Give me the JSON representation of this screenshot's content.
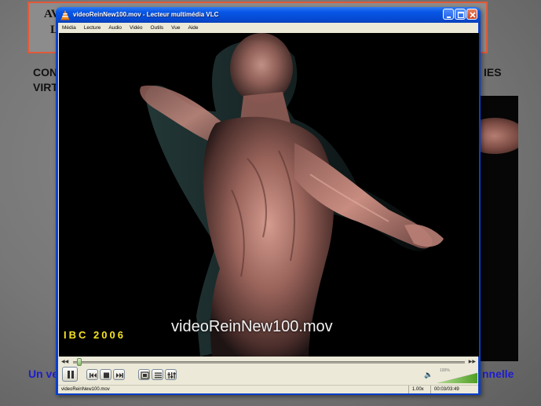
{
  "slide": {
    "fragment_1": "AV",
    "fragment_2": "L",
    "title_left_1": "CON",
    "title_left_2": "VIRT",
    "title_right": "IES",
    "bottom_left": "Un ve",
    "bottom_right": "nnelle"
  },
  "window": {
    "title": "videoReinNew100.mov - Lecteur multimédia VLC",
    "minimize_icon": "minimize-icon",
    "maximize_icon": "maximize-icon",
    "close_icon": "close-icon"
  },
  "menu": [
    "Média",
    "Lecture",
    "Audio",
    "Vidéo",
    "Outils",
    "Vue",
    "Aide"
  ],
  "video": {
    "watermark": "IBC 2006",
    "caption": "videoReinNew100.mov",
    "watermark_color": "#f5e222"
  },
  "controls": {
    "progress": 0.01,
    "volume_percent": "100%",
    "volume_icon": "speaker-icon"
  },
  "status": {
    "filename": "videoReinNew100.mov",
    "speed": "1.00x",
    "time": "00:03/03:49"
  },
  "colors": {
    "titlebar": "#0857e7",
    "window_bg": "#ece9d8",
    "slide_border": "#e05a3a",
    "slide_bottom_text": "#1d1dcf"
  }
}
